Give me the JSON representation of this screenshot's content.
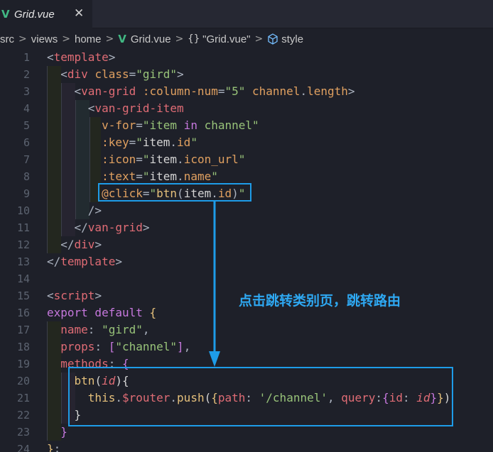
{
  "tab": {
    "icon": "vue-logo-icon",
    "title": "Grid.vue",
    "close": "✕"
  },
  "breadcrumb": {
    "items": [
      "src",
      "views",
      "home",
      "Grid.vue",
      "\"Grid.vue\"",
      "style"
    ],
    "separator": ">",
    "braces": "{}"
  },
  "annotation": "点击跳转类别页，跳转路由",
  "colors": {
    "tag": "#e06c75",
    "attribute": "#e0a060",
    "string": "#98c379",
    "highlight_box": "#1e9ce8",
    "annotation": "#2ea8f2",
    "vue": "#41b883"
  },
  "code_lines": [
    {
      "n": "1",
      "tokens": [
        [
          "<",
          "punc"
        ],
        [
          "template",
          "tag"
        ],
        [
          ">",
          "punc"
        ]
      ]
    },
    {
      "n": "2",
      "tokens": [
        [
          "  <",
          "punc"
        ],
        [
          "div",
          "tag"
        ],
        [
          " class",
          "attr"
        ],
        [
          "=",
          "punc"
        ],
        [
          "\"gird\"",
          "str"
        ],
        [
          ">",
          "punc"
        ]
      ]
    },
    {
      "n": "3",
      "tokens": [
        [
          "    <",
          "punc"
        ],
        [
          "van-grid",
          "tag"
        ],
        [
          " :column-num",
          "attr"
        ],
        [
          "=",
          "punc"
        ],
        [
          "\"5\"",
          "str"
        ],
        [
          " channel",
          "attr"
        ],
        [
          ".",
          "punc"
        ],
        [
          "length",
          "attr"
        ],
        [
          ">",
          "punc"
        ]
      ]
    },
    {
      "n": "4",
      "tokens": [
        [
          "      <",
          "punc"
        ],
        [
          "van-grid-item",
          "tag"
        ]
      ]
    },
    {
      "n": "5",
      "tokens": [
        [
          "        v-for",
          "attr"
        ],
        [
          "=",
          "punc"
        ],
        [
          "\"",
          "str"
        ],
        [
          "item",
          "str"
        ],
        [
          " in ",
          "kw"
        ],
        [
          "channel",
          "str"
        ],
        [
          "\"",
          "str"
        ]
      ]
    },
    {
      "n": "6",
      "tokens": [
        [
          "        :key",
          "attr"
        ],
        [
          "=",
          "punc"
        ],
        [
          "\"",
          "str"
        ],
        [
          "item",
          "plain"
        ],
        [
          ".",
          "punc"
        ],
        [
          "id",
          "attr"
        ],
        [
          "\"",
          "str"
        ]
      ]
    },
    {
      "n": "7",
      "tokens": [
        [
          "        :icon",
          "attr"
        ],
        [
          "=",
          "punc"
        ],
        [
          "\"",
          "str"
        ],
        [
          "item",
          "plain"
        ],
        [
          ".",
          "punc"
        ],
        [
          "icon_url",
          "attr"
        ],
        [
          "\"",
          "str"
        ]
      ]
    },
    {
      "n": "8",
      "tokens": [
        [
          "        :text",
          "attr"
        ],
        [
          "=",
          "punc"
        ],
        [
          "\"",
          "str"
        ],
        [
          "item",
          "plain"
        ],
        [
          ".",
          "punc"
        ],
        [
          "name",
          "attr"
        ],
        [
          "\"",
          "str"
        ]
      ]
    },
    {
      "n": "9",
      "tokens": [
        [
          "        @click",
          "attr"
        ],
        [
          "=",
          "punc"
        ],
        [
          "\"",
          "str"
        ],
        [
          "btn",
          "ident"
        ],
        [
          "(",
          "punc"
        ],
        [
          "item",
          "plain"
        ],
        [
          ".",
          "punc"
        ],
        [
          "id",
          "attr"
        ],
        [
          ")",
          "punc"
        ],
        [
          "\"",
          "str"
        ]
      ]
    },
    {
      "n": "10",
      "tokens": [
        [
          "      />",
          "punc"
        ]
      ]
    },
    {
      "n": "11",
      "tokens": [
        [
          "    </",
          "punc"
        ],
        [
          "van-grid",
          "tag"
        ],
        [
          ">",
          "punc"
        ]
      ]
    },
    {
      "n": "12",
      "tokens": [
        [
          "  </",
          "punc"
        ],
        [
          "div",
          "tag"
        ],
        [
          ">",
          "punc"
        ]
      ]
    },
    {
      "n": "13",
      "tokens": [
        [
          "</",
          "punc"
        ],
        [
          "template",
          "tag"
        ],
        [
          ">",
          "punc"
        ]
      ]
    },
    {
      "n": "14",
      "tokens": []
    },
    {
      "n": "15",
      "tokens": [
        [
          "<",
          "punc"
        ],
        [
          "script",
          "tag"
        ],
        [
          ">",
          "punc"
        ]
      ]
    },
    {
      "n": "16",
      "tokens": [
        [
          "export",
          "kw"
        ],
        [
          " default ",
          "kw"
        ],
        [
          "{",
          "ident"
        ]
      ]
    },
    {
      "n": "17",
      "tokens": [
        [
          "  name",
          "prop"
        ],
        [
          ": ",
          "punc"
        ],
        [
          "\"gird\"",
          "str"
        ],
        [
          ",",
          "punc"
        ]
      ]
    },
    {
      "n": "18",
      "tokens": [
        [
          "  props",
          "prop"
        ],
        [
          ": ",
          "punc"
        ],
        [
          "[",
          "kw"
        ],
        [
          "\"channel\"",
          "str"
        ],
        [
          "]",
          "kw"
        ],
        [
          ",",
          "punc"
        ]
      ]
    },
    {
      "n": "19",
      "tokens": [
        [
          "  methods",
          "prop"
        ],
        [
          ": ",
          "punc"
        ],
        [
          "{",
          "kw"
        ]
      ]
    },
    {
      "n": "20",
      "tokens": [
        [
          "    btn",
          "ident"
        ],
        [
          "(",
          "plain"
        ],
        [
          "id",
          "param"
        ],
        [
          "){",
          "plain"
        ]
      ]
    },
    {
      "n": "21",
      "tokens": [
        [
          "      this",
          "ident"
        ],
        [
          ".",
          "punc"
        ],
        [
          "$router",
          "prop"
        ],
        [
          ".",
          "punc"
        ],
        [
          "push",
          "ident"
        ],
        [
          "(",
          "plain"
        ],
        [
          "{",
          "ident"
        ],
        [
          "path",
          "prop"
        ],
        [
          ": ",
          "punc"
        ],
        [
          "'/channel'",
          "str"
        ],
        [
          ", ",
          "punc"
        ],
        [
          "query",
          "prop"
        ],
        [
          ":",
          "punc"
        ],
        [
          "{",
          "kw"
        ],
        [
          "id",
          "prop"
        ],
        [
          ": ",
          "punc"
        ],
        [
          "id",
          "param"
        ],
        [
          "}",
          "kw"
        ],
        [
          "}",
          "ident"
        ],
        [
          ")",
          "plain"
        ]
      ]
    },
    {
      "n": "22",
      "tokens": [
        [
          "    }",
          "plain"
        ]
      ]
    },
    {
      "n": "23",
      "tokens": [
        [
          "  }",
          "kw"
        ]
      ]
    },
    {
      "n": "24",
      "tokens": [
        [
          "}",
          "ident"
        ],
        [
          ";",
          "punc"
        ]
      ]
    }
  ]
}
